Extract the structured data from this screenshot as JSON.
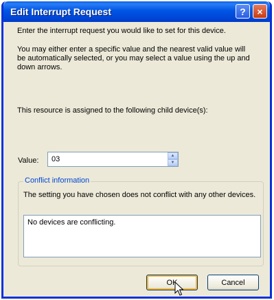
{
  "window": {
    "title": "Edit Interrupt Request",
    "help_icon": "?",
    "close_icon": "×"
  },
  "intro_text": "Enter the interrupt request you would like to set for this device.",
  "instructions_text": "You may either enter a specific value and the nearest valid value will be automatically selected, or you may select a value using the up and down arrows.",
  "assignment_text": "This resource is assigned to the following child device(s):",
  "value_field": {
    "label": "Value:",
    "value": "03",
    "spinner_up": "▲",
    "spinner_down": "▼"
  },
  "conflict": {
    "legend": "Conflict information",
    "description": "The setting you have chosen does not conflict with any other devices.",
    "box_text": "No devices are conflicting."
  },
  "buttons": {
    "ok": "OK",
    "cancel": "Cancel"
  },
  "colors": {
    "titlebar": "#0055e5",
    "window_bg": "#ece9d8",
    "group_legend": "#0046d5"
  }
}
